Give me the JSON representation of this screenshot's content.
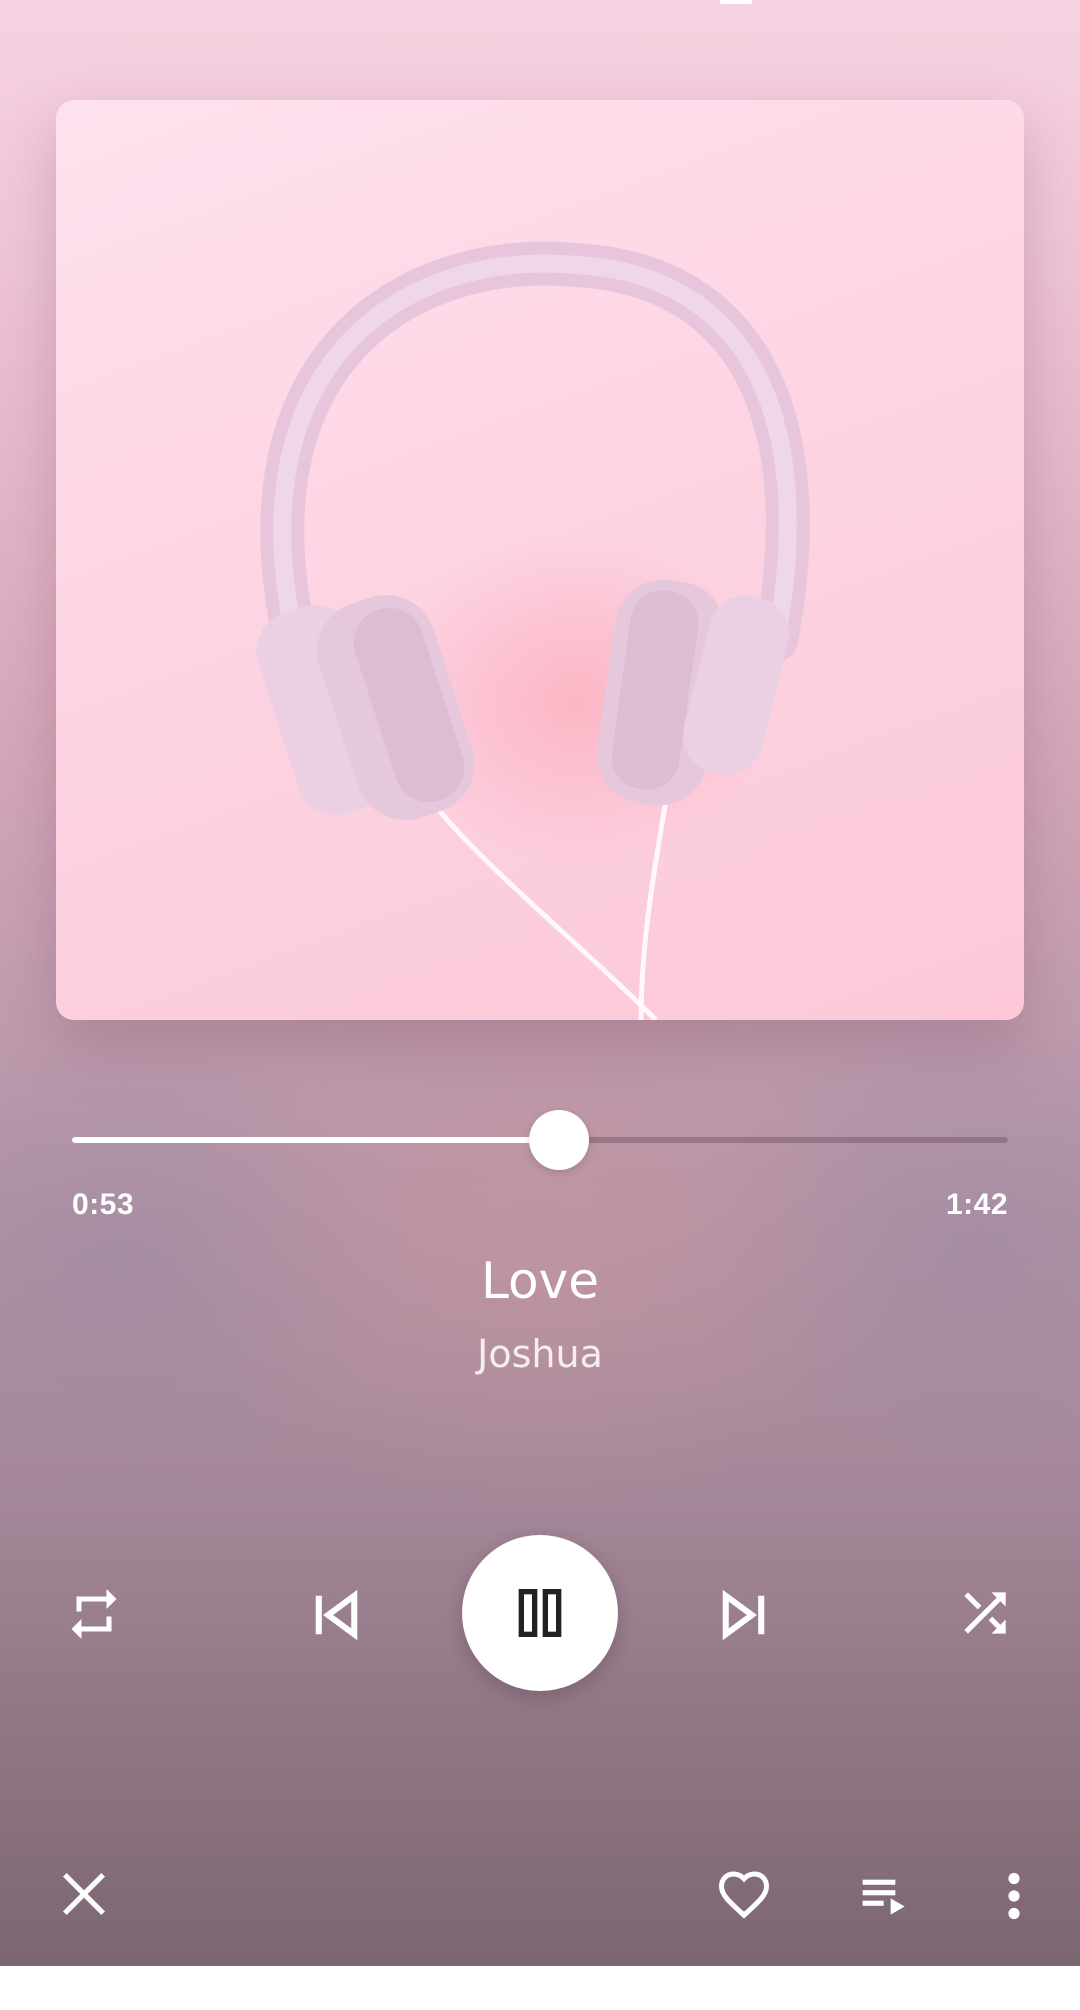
{
  "app": {
    "accent_color": "#ffffff",
    "background_top": "#f6d3e2",
    "background_bottom": "#7c6673"
  },
  "album_art": {
    "subject": "white headphones on pink background"
  },
  "progress": {
    "elapsed": "0:53",
    "total": "1:42",
    "fraction": 0.52
  },
  "track": {
    "title": "Love",
    "artist": "Joshua"
  },
  "controls": {
    "repeat_icon": "repeat-icon",
    "previous_icon": "skip-previous-icon",
    "play_pause_icon": "pause-icon",
    "next_icon": "skip-next-icon",
    "shuffle_icon": "shuffle-icon"
  },
  "bottom_bar": {
    "close_icon": "close-icon",
    "like_icon": "heart-icon",
    "queue_icon": "queue-icon",
    "more_icon": "more-vert-icon"
  }
}
